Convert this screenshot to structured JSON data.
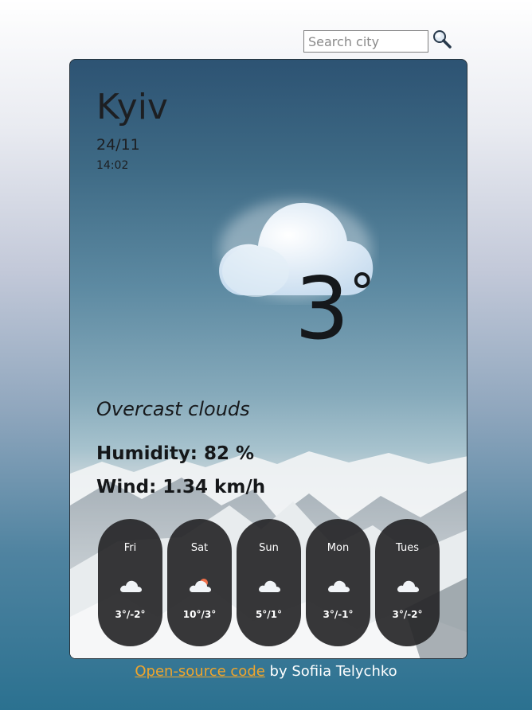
{
  "search": {
    "placeholder": "Search city"
  },
  "weather": {
    "city": "Kyiv",
    "date": "24/11",
    "time": "14:02",
    "temperature": "3",
    "degree_symbol": "°",
    "description": "Overcast clouds",
    "humidity": "Humidity: 82 %",
    "wind": "Wind: 1.34 km/h"
  },
  "forecast": [
    {
      "day": "Fri",
      "temp": "3°/-2°",
      "icon": "cloud-icon"
    },
    {
      "day": "Sat",
      "temp": "10°/3°",
      "icon": "sun-cloud-icon"
    },
    {
      "day": "Sun",
      "temp": "5°/1°",
      "icon": "cloud-icon"
    },
    {
      "day": "Mon",
      "temp": "3°/-1°",
      "icon": "cloud-icon"
    },
    {
      "day": "Tues",
      "temp": "3°/-2°",
      "icon": "cloud-icon"
    }
  ],
  "footer": {
    "link_text": "Open-source code",
    "suffix": " by Sofiia Telychko"
  },
  "colors": {
    "link": "#f0a52c",
    "pill": "#262628",
    "text_dark": "#1d1f22"
  }
}
